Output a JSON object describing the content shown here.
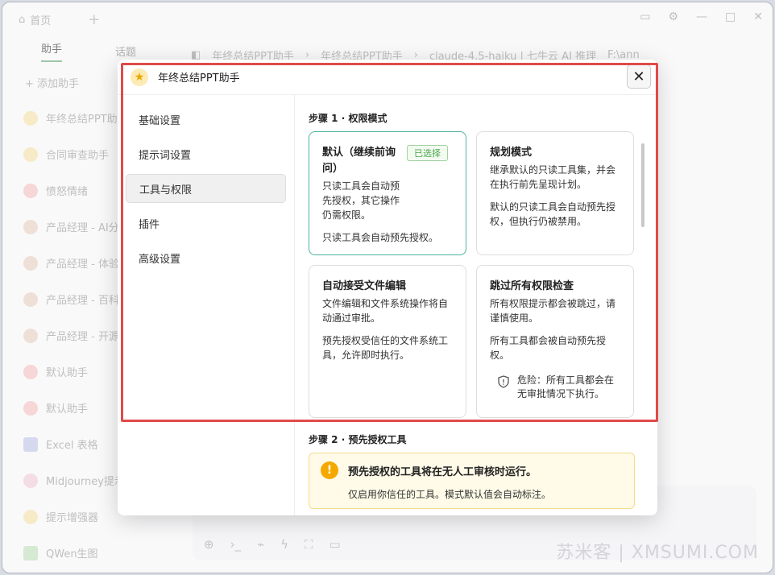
{
  "app": {
    "home_tab": "首页",
    "sidebar_tabs": [
      "助手",
      "话题"
    ],
    "add_assistant": "添加助手",
    "assistants": [
      {
        "label": "年终总结PPT助",
        "icon": "star-icon"
      },
      {
        "label": "合同审查助手",
        "icon": "star-icon"
      },
      {
        "label": "愤怒情绪",
        "icon": "face-icon"
      },
      {
        "label": "产品经理 - AI分",
        "icon": "person-icon"
      },
      {
        "label": "产品经理 - 体验",
        "icon": "person-icon"
      },
      {
        "label": "产品经理 - 百科",
        "icon": "person-icon"
      },
      {
        "label": "产品经理 - 开源",
        "icon": "person-icon"
      },
      {
        "label": "默认助手",
        "icon": "face-icon"
      },
      {
        "label": "默认助手",
        "icon": "face-icon"
      },
      {
        "label": "Excel 表格",
        "icon": "sheet-icon"
      },
      {
        "label": "Midjourney提示",
        "icon": "brush-icon"
      },
      {
        "label": "提示增强器",
        "icon": "sparkle-icon"
      },
      {
        "label": "QWen生图",
        "icon": "image-icon"
      }
    ],
    "breadcrumb": [
      "年终总结PPT助手",
      "年终总结PPT助手",
      "claude-4.5-haiku | 七牛云 AI 推理"
    ],
    "path": "F:\\ann"
  },
  "modal": {
    "title": "年终总结PPT助手",
    "nav": [
      "基础设置",
      "提示词设置",
      "工具与权限",
      "插件",
      "高级设置"
    ],
    "active_nav": "工具与权限",
    "step1_title": "步骤 1 · 权限模式",
    "cards": [
      {
        "title": "默认（继续前询问）",
        "badge": "已选择",
        "desc": "只读工具会自动预先授权，其它操作仍需权限。",
        "note": "只读工具会自动预先授权。"
      },
      {
        "title": "规划模式",
        "desc": "继承默认的只读工具集，并会在执行前先呈现计划。",
        "note": "默认的只读工具会自动预先授权，但执行仍被禁用。"
      },
      {
        "title": "自动接受文件编辑",
        "desc": "文件编辑和文件系统操作将自动通过审批。",
        "note": "预先授权受信任的文件系统工具，允许即时执行。"
      },
      {
        "title": "跳过所有权限检查",
        "desc": "所有权限提示都会被跳过，请谨慎使用。",
        "note": "所有工具都会被自动预先授权。",
        "danger": "危险：所有工具都会在无审批情况下执行。"
      }
    ],
    "step2_title": "步骤 2 · 预先授权工具",
    "warn_title": "预先授权的工具将在无人工审核时运行。",
    "warn_sub": "仅启用你信任的工具。模式默认值会自动标注。"
  },
  "watermark": "苏米客 | XMSUMI.COM",
  "colors": {
    "highlight": "#e04a4a",
    "selected_border": "#4fb3a0",
    "warn_bg": "#fffbe8"
  }
}
